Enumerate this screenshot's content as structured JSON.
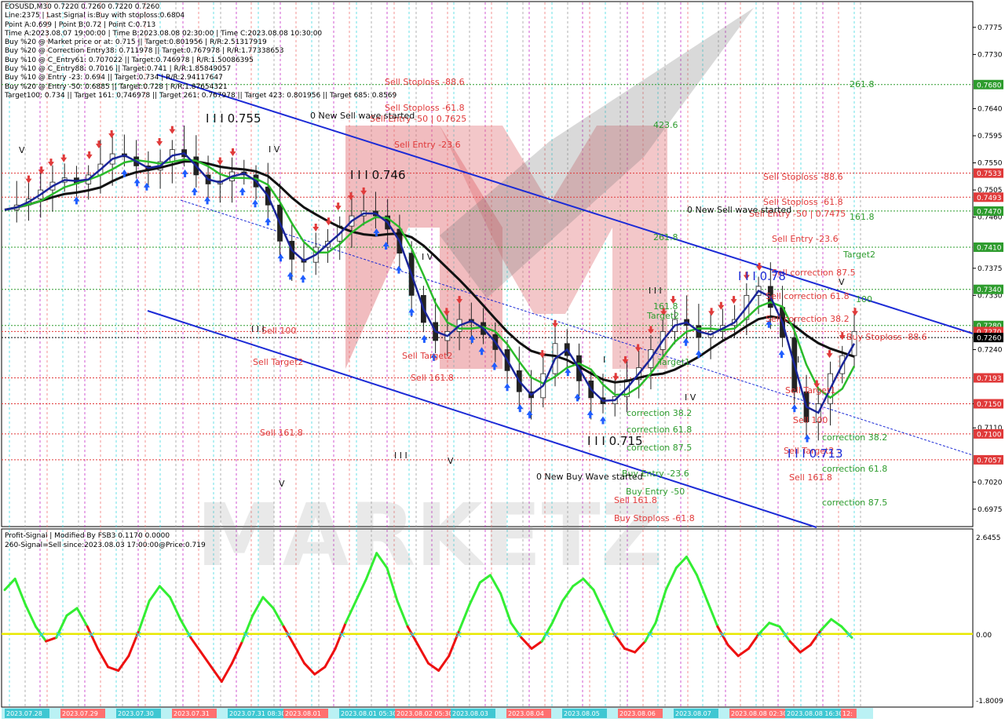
{
  "window": {
    "symbol_line": "EOSUSD,M30  0.7220 0.7260 0.7220 0.7260"
  },
  "info_lines": [
    "Line:2375 | Last Signal is:Buy with stoploss:0.6804",
    "Point A:0.699 | Point B:0.72 | Point C:0.713",
    "Time A:2023.08.07 19:00:00 | Time B:2023.08.08 02:30:00 | Time C:2023.08.08 10:30:00",
    "Buy %20 @ Market price or at: 0.715 || Target:0.801956 | R/R:2.51317919",
    "Buy %20 @ Correction Entry38: 0.711978 || Target:0.767978 | R/R:1.77338653",
    "Buy %10 @ C_Entry61: 0.707022 || Target:0.746978 | R/R:1.50086395",
    "Buy %10 @ C_Entry88: 0.7016 || Target:0.741 | R/R:1.85849057",
    "Buy %10 @ Entry -23: 0.694 || Target:0.734 | R/R:2.94117647",
    "Buy %20 @ Entry -50: 0.6885 || Target:0.728 | R/R:1.87654321",
    "Target100: 0.734 || Target 161: 0.746978 || Target 261: 0.767978 || Target 423: 0.801956 || Target 685: 0.8569"
  ],
  "indicator": {
    "title": "Profit-Signal | Modified By FSB3 0.1170 0.0000",
    "signal_text": "260-Signal=Sell since:2023.08.03 17:00:00@Price:0.719",
    "scale": [
      "2.6455",
      "0.00",
      "-1.8009"
    ]
  },
  "price_axis": {
    "ticks": [
      "0.7775",
      "0.7730",
      "0.7640",
      "0.7595",
      "0.7550",
      "0.7505",
      "0.7460",
      "0.7375",
      "0.7330",
      "0.7240",
      "0.7150",
      "0.7110",
      "0.7020",
      "0.6975"
    ],
    "highlighted": [
      {
        "label": "0.7680",
        "color": "#2e9c2e"
      },
      {
        "label": "0.7533",
        "color": "#e03a3a"
      },
      {
        "label": "0.7493",
        "color": "#e03a3a"
      },
      {
        "label": "0.7470",
        "color": "#2e9c2e"
      },
      {
        "label": "0.7410",
        "color": "#2e9c2e"
      },
      {
        "label": "0.7340",
        "color": "#2e9c2e"
      },
      {
        "label": "0.7280",
        "color": "#2e9c2e"
      },
      {
        "label": "0.7270",
        "color": "#e03a3a"
      },
      {
        "label": "0.7260",
        "color": "#000000"
      },
      {
        "label": "0.7193",
        "color": "#e03a3a"
      },
      {
        "label": "0.7150",
        "color": "#e03a3a"
      },
      {
        "label": "0.7100",
        "color": "#e03a3a"
      },
      {
        "label": "0.7057",
        "color": "#e03a3a"
      }
    ]
  },
  "time_axis": [
    "2023.07.28",
    "2023.07.29",
    "2023.07.30",
    "2023.07.31",
    "2023.07.31 08:30",
    "2023.08.01",
    "2023.08.01 05:30",
    "2023.08.02 05:30",
    "2023.08.03",
    "2023.08.04",
    "2023.08.05",
    "2023.08.06",
    "2023.08.07",
    "2023.08.08 02:30",
    "2023.08.08 16:30",
    "12:"
  ],
  "annotations": {
    "red": [
      "Sell Stoploss -88.6",
      "Sell Stoploss -61.8",
      "Sell Entry -50 | 0.7625",
      "Sell Entry -23.6",
      "Sell Stoploss -88.6",
      "Sell Stoploss -61.8",
      "Sell Entry -50 | 0.7475",
      "Sell Entry -23.6",
      "Sell correction 87.5",
      "Sell correction 61.8",
      "Sell correction 38.2",
      "Sell 100",
      "Sell Target2",
      "Sell 161.8",
      "Sell Target2",
      "Sell 161.8",
      "Sell 161.8",
      "Sell Target1",
      "Sell 100",
      "Sell Target2",
      "Sell 161.8",
      "Buy Stoploss -61.8",
      "Buy Stoploss -88.6",
      "Target1"
    ],
    "green": [
      "261.8",
      "423.6",
      "161.8",
      "Target2",
      "100",
      "261.8",
      "161.8",
      "Target2",
      "Target1",
      "correction 38.2",
      "correction 61.8",
      "correction 87.5",
      "Buy Entry -23.6",
      "Buy Entry -50",
      "correction 38.2",
      "correction 61.8",
      "correction 87.5"
    ],
    "dark": [
      "0 New Sell wave started",
      "0 New Sell wave started",
      "0 New Buy Wave started",
      "I I I 0.755",
      "I I I 0.746",
      "I I I 0.715",
      "I I I 0.78",
      "I I I 0.713",
      "I V",
      "I V",
      "I V",
      "I I I",
      "V",
      "V",
      "V",
      "V",
      "I I I",
      "I I I",
      "I",
      "I"
    ]
  },
  "watermark": "MARKETZ",
  "colors": {
    "bg": "#ffffff",
    "panel": "#ebebeb",
    "grid": "#c9c9c9",
    "sell": "#e03a3a",
    "buy": "#2e9c2e",
    "channel": "#1c2bd6",
    "black_ma": "#111111",
    "green_ma": "#2bbb2b",
    "blue_ma": "#1a2599",
    "osc_pos": "#33ee33",
    "osc_neg": "#ee1111",
    "zero": "#e8e800",
    "cyan": "#38d6e0",
    "magenta": "#c31fc3"
  },
  "chart_data": {
    "type": "line",
    "title": "EOSUSD,M30",
    "ylim": [
      0.695,
      0.781
    ],
    "close": [
      0.7472,
      0.748,
      0.749,
      0.7505,
      0.7518,
      0.7525,
      0.7515,
      0.753,
      0.7548,
      0.7565,
      0.756,
      0.7545,
      0.7538,
      0.7552,
      0.7572,
      0.756,
      0.753,
      0.7515,
      0.752,
      0.7535,
      0.753,
      0.751,
      0.748,
      0.742,
      0.739,
      0.7385,
      0.741,
      0.742,
      0.7445,
      0.7462,
      0.747,
      0.7462,
      0.744,
      0.74,
      0.733,
      0.7285,
      0.7255,
      0.727,
      0.729,
      0.7285,
      0.7265,
      0.724,
      0.7205,
      0.717,
      0.716,
      0.72,
      0.725,
      0.723,
      0.7188,
      0.716,
      0.715,
      0.7162,
      0.719,
      0.721,
      0.724,
      0.727,
      0.729,
      0.728,
      0.726,
      0.727,
      0.728,
      0.729,
      0.733,
      0.7345,
      0.731,
      0.726,
      0.717,
      0.712,
      0.715,
      0.72,
      0.723,
      0.727
    ],
    "series": [
      {
        "name": "Buy Stoploss -88.6",
        "values": [
          0.698
        ]
      },
      {
        "name": "Sell Stoploss -88.6",
        "values": [
          0.7533
        ]
      }
    ],
    "levels": [
      0.768,
      0.7533,
      0.7493,
      0.747,
      0.741,
      0.734,
      0.728,
      0.727,
      0.726,
      0.7193,
      0.715,
      0.71,
      0.7057
    ],
    "oscillator": [
      1.2,
      1.5,
      0.8,
      0.2,
      -0.2,
      -0.1,
      0.5,
      0.7,
      0.2,
      -0.4,
      -0.9,
      -1.0,
      -0.6,
      0.1,
      0.9,
      1.3,
      1.0,
      0.4,
      -0.1,
      -0.5,
      -0.9,
      -1.3,
      -0.8,
      -0.2,
      0.5,
      1.0,
      0.7,
      0.2,
      -0.3,
      -0.8,
      -1.1,
      -0.9,
      -0.4,
      0.3,
      0.9,
      1.5,
      2.2,
      1.8,
      0.9,
      0.2,
      -0.3,
      -0.8,
      -1.0,
      -0.6,
      0.1,
      0.8,
      1.4,
      1.6,
      1.1,
      0.3,
      -0.1,
      -0.4,
      -0.2,
      0.3,
      0.9,
      1.3,
      1.5,
      1.2,
      0.6,
      0.0,
      -0.4,
      -0.5,
      -0.2,
      0.3,
      1.2,
      1.8,
      2.1,
      1.6,
      0.9,
      0.2,
      -0.3,
      -0.6,
      -0.4,
      0.0,
      0.3,
      0.2,
      -0.2,
      -0.5,
      -0.3,
      0.1,
      0.4,
      0.2,
      -0.1
    ]
  }
}
